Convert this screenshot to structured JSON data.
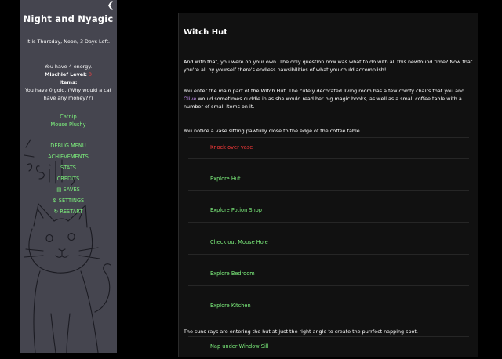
{
  "sidebar": {
    "collapse_icon": "chevron-left-icon",
    "title": "Night and Nyagic",
    "time_line": "It is Thursday, Noon, 3 Days Left.",
    "energy_line": "You have 4 energy.",
    "mischief_label": "Mischief Level:",
    "mischief_value": "0",
    "items_label": "Items:",
    "gold_line": "You have 0 gold. (Why would a cat have any money??)",
    "items": [
      "Catnip",
      "Mouse Plushy"
    ],
    "menu": [
      {
        "label": "DEBUG MENU",
        "icon": ""
      },
      {
        "label": "ACHIEVEMENTS",
        "icon": ""
      },
      {
        "label": "STATS",
        "icon": ""
      },
      {
        "label": "CREDITS",
        "icon": ""
      },
      {
        "label": "SAVES",
        "icon": "save-icon"
      },
      {
        "label": "SETTINGS",
        "icon": "gear-icon"
      },
      {
        "label": "RESTART",
        "icon": "restart-icon"
      }
    ]
  },
  "passage": {
    "title": "Witch Hut",
    "para1": "And with that, you were on your own. The only question now was what to do with all this newfound time? Now that you're all by yourself there's endless pawsibilities of what you could accomplish!",
    "para2_a": "You enter the main part of the Witch Hut. The cutely decorated living room has a few comfy chairs that you and ",
    "para2_name": "Olive",
    "para2_b": " would sometimes cuddle in as she would read her big magic books, as well as a small coffee table with a number of small items on it.",
    "para3": "You notice a vase sitting pawfully close to the edge of the coffee table...",
    "choices": [
      "Knock over vase",
      "Explore Hut",
      "Explore Potion Shop",
      "Check out Mouse Hole",
      "Explore Bedroom",
      "Explore Kitchen"
    ],
    "para4": "The suns rays are entering the hut at just the right angle to create the purrfect napping spot.",
    "choice_nap": "Nap under Window Sill"
  },
  "colors": {
    "sidebar_bg": "#45454f",
    "link_green": "#7df07d",
    "danger_red": "#ff3b3b",
    "olive_purple": "#c48ff0"
  }
}
